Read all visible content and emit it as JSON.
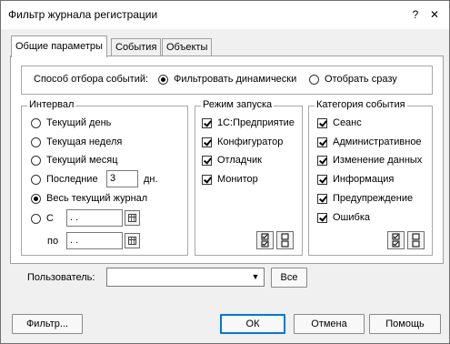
{
  "window": {
    "title": "Фильтр журнала регистрации",
    "help_glyph": "?",
    "close_glyph": "✕"
  },
  "tabs": [
    {
      "label": "Общие параметры",
      "active": true
    },
    {
      "label": "События",
      "active": false
    },
    {
      "label": "Объекты",
      "active": false
    }
  ],
  "selection": {
    "label": "Способ отбора событий:",
    "options": [
      {
        "label": "Фильтровать динамически",
        "selected": true
      },
      {
        "label": "Отобрать сразу",
        "selected": false
      }
    ]
  },
  "interval": {
    "title": "Интервал",
    "options": {
      "today": {
        "label": "Текущий день",
        "selected": false
      },
      "week": {
        "label": "Текущая неделя",
        "selected": false
      },
      "month": {
        "label": "Текущий месяц",
        "selected": false
      },
      "last": {
        "label": "Последние",
        "selected": false,
        "value": "3",
        "unit": "дн."
      },
      "all": {
        "label": "Весь текущий журнал",
        "selected": true
      },
      "from": {
        "label": "С",
        "selected": false,
        "value": " .  ."
      }
    },
    "to_label": "по",
    "to_value": " .  ."
  },
  "launch_mode": {
    "title": "Режим запуска",
    "items": [
      {
        "label": "1С:Предприятие",
        "checked": true
      },
      {
        "label": "Конфигуратор",
        "checked": true
      },
      {
        "label": "Отладчик",
        "checked": true
      },
      {
        "label": "Монитор",
        "checked": true
      }
    ]
  },
  "event_category": {
    "title": "Категория события",
    "items": [
      {
        "label": "Сеанс",
        "checked": true
      },
      {
        "label": "Административное",
        "checked": true
      },
      {
        "label": "Изменение данных",
        "checked": true
      },
      {
        "label": "Информация",
        "checked": true
      },
      {
        "label": "Предупреждение",
        "checked": true
      },
      {
        "label": "Ошибка",
        "checked": true
      }
    ]
  },
  "user": {
    "label": "Пользователь:",
    "value": "",
    "all_button": "Все",
    "dropdown_glyph": "▼"
  },
  "buttons": {
    "filter": "Фильтр...",
    "ok": "ОК",
    "cancel": "Отмена",
    "help": "Помощь"
  },
  "icons": {
    "select_all": "check-all-icon",
    "deselect_all": "uncheck-all-icon",
    "calendar": "calendar-icon"
  }
}
